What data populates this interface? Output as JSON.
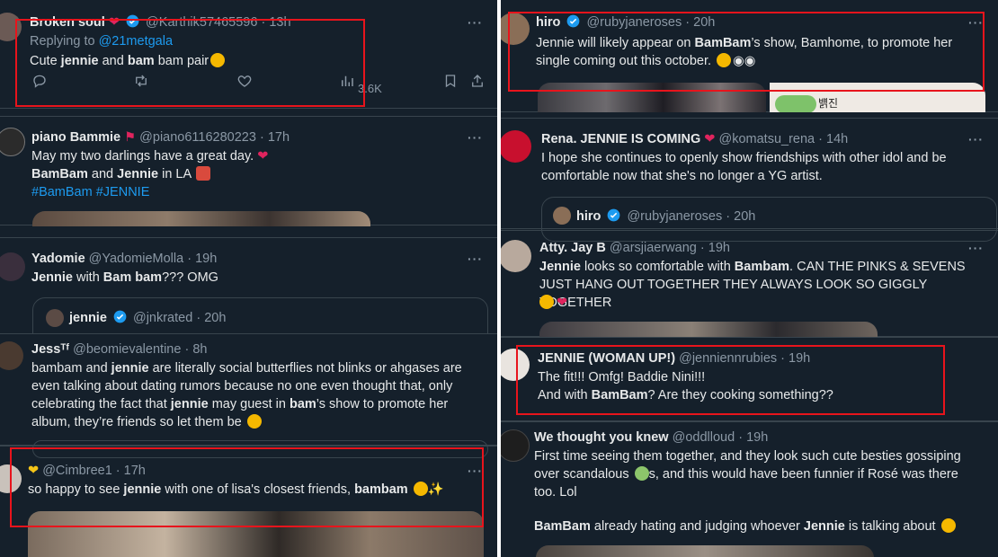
{
  "left_column": {
    "t1": {
      "name": "Broken soul",
      "name_emoji": "broken-heart-emoji",
      "handle": "@Karthik57465596",
      "time": "13h",
      "replying_prefix": "Replying to",
      "replying_to": "@21metgala",
      "text_a": "Cute",
      "text_b": "jennie",
      "text_c": "and",
      "text_d": "bam",
      "text_e": "bam pair",
      "views": "3.6K"
    },
    "t2": {
      "name": "piano  Bammie",
      "handle": "@piano6116280223",
      "time": "17h",
      "line1": "May my two darlings have a great day.",
      "line2_a": "BamBam",
      "line2_b": "and",
      "line2_c": "Jennie",
      "line2_d": "in LA",
      "hashtag1": "#BamBam",
      "hashtag2": "#JENNIE"
    },
    "t3": {
      "name": "Yadomie",
      "handle": "@YadomieMolla",
      "time": "19h",
      "text_a": "Jennie",
      "text_b": "with",
      "text_c": "Bam bam",
      "text_d": "??? OMG",
      "quote_name": "jennie",
      "quote_handle": "@jnkrated",
      "quote_time": "20h"
    },
    "t4": {
      "name": "Jessᵀᶠ",
      "handle": "@beomievalentine",
      "time": "8h",
      "l1_a": "bambam and",
      "l1_b": "jennie",
      "l1_c": "are literally social butterflies not blinks or ahgases are",
      "l2": "even talking about dating rumors because no one even thought that, only",
      "l3_a": "celebrating the fact that",
      "l3_b": "jennie",
      "l3_c": "may guest in",
      "l3_d": "bam",
      "l3_e": "’s show to promote her",
      "l4": "album, they’re friends so let them be"
    },
    "t5": {
      "handle": "@Cimbree1",
      "time": "17h",
      "text_a": "so happy to see",
      "text_b": "jennie",
      "text_c": "with one of lisa's closest friends,",
      "text_d": "bambam"
    }
  },
  "right_column": {
    "t1": {
      "name": "hiro",
      "handle": "@rubyjaneroses",
      "time": "20h",
      "l1_a": "Jennie will likely appear on",
      "l1_b": "BamBam",
      "l1_c": "’s show, Bamhome, to promote her",
      "l2": "single coming out this october.",
      "media_korean": "뱱진"
    },
    "t2": {
      "name": "Rena. JENNIE IS COMING",
      "handle": "@komatsu_rena",
      "time": "14h",
      "l1": "I hope she continues to openly show friendships with other idol and be",
      "l2": "comfortable now that she's no longer a YG artist.",
      "quote_name": "hiro",
      "quote_handle": "@rubyjaneroses",
      "quote_time": "20h"
    },
    "t3": {
      "name": "Atty. Jay B",
      "handle": "@arsjiaerwang",
      "time": "19h",
      "l1_a": "Jennie",
      "l1_b": "looks so comfortable with",
      "l1_c": "Bambam",
      "l1_d": ". CAN THE PINKS & SEVENS",
      "l2": "JUST HANG OUT TOGETHER THEY ALWAYS LOOK SO GIGGLY TOGETHER"
    },
    "t4": {
      "name": "JENNIE (WOMAN UP!)",
      "handle": "@jenniennrubies",
      "time": "19h",
      "l1": "The fit!!! Omfg! Baddie Nini!!!",
      "l2_a": "And with",
      "l2_b": "BamBam",
      "l2_c": "? Are they cooking something??"
    },
    "t5": {
      "name": "We thought you knew",
      "handle": "@oddlloud",
      "time": "19h",
      "l1": "First time seeing them together, and they look such cute besties gossiping",
      "l2_a": "over scandalous",
      "l2_b": "s, and this would have been funnier if Rosé was there",
      "l3": "too. Lol",
      "l4_a": "BamBam",
      "l4_b": "already hating and judging whoever",
      "l4_c": "Jennie",
      "l4_d": "is talking about"
    }
  },
  "ui": {
    "more_label": "···",
    "dot": "·"
  },
  "colors": {
    "background": "#15202b",
    "divider": "#38444d",
    "text": "#e7e9ea",
    "muted": "#8b98a5",
    "link": "#1d9bf0",
    "highlight_box": "#e8141c"
  }
}
